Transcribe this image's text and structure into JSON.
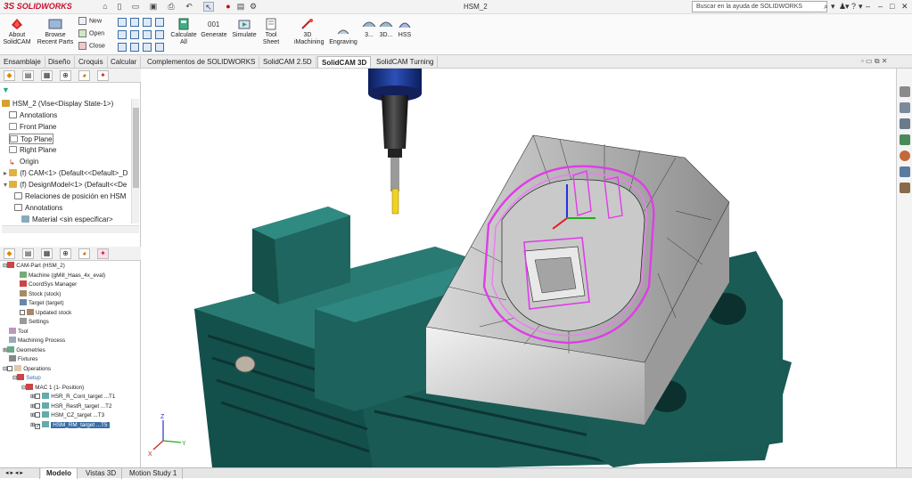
{
  "app": {
    "logo_ds": "3S",
    "logo_text": "SOLIDWORKS",
    "doc_title": "HSM_2",
    "help_search_placeholder": "Buscar en la ayuda de SOLIDWORKS",
    "win_controls": [
      "?",
      "–",
      "□",
      "✕"
    ],
    "help_icons": [
      "⌕",
      "▾",
      "♟",
      "▾",
      "?",
      "▾"
    ]
  },
  "ribbon": {
    "about": "About SolidCAM",
    "browse": "Browse Recent Parts",
    "new": "New",
    "open": "Open",
    "close": "Close",
    "calculate_all": "Calculate All",
    "generate": "Generate",
    "simulate": "Simulate",
    "tool_sheet": "Tool Sheet",
    "imachining": "3D iMachining",
    "engraving": "Engraving",
    "btn_3": "3...",
    "btn_3d": "3D...",
    "hss": "HSS"
  },
  "tabs": [
    "Ensamblaje",
    "Diseño",
    "Croquis",
    "Calcular",
    "Complementos de SOLIDWORKS",
    "SolidCAM 2.5D",
    "SolidCAM 3D",
    "SolidCAM Turning"
  ],
  "active_tab": "SolidCAM 3D",
  "feature_tree": {
    "root": "HSM_2  (Vise<Display State-1>)",
    "items": [
      "Annotations",
      "Front Plane",
      "Top Plane",
      "Right Plane",
      "Origin",
      "(f) CAM<1> (Default<<Default>_D",
      "(f) DesignModel<1> (Default<<De",
      "Relaciones de posición en HSM",
      "Annotations",
      "Material <sin especificar>"
    ]
  },
  "cam_tree": {
    "items": [
      "CAM-Part (HSM_2)",
      "Machine (gMill_Haas_4x_eval)",
      "CoordSys Manager",
      "Stock (stock)",
      "Target (target)",
      "Updated stock",
      "Settings",
      "Tool",
      "Machining Process",
      "Geometries",
      "Fixtures",
      "Operations",
      "Setup",
      "MAC 1 (1- Position)",
      "HSR_R_Cont_target ...T1",
      "HSR_RestR_target ...T2",
      "HSM_CZ_target ...T3",
      "HSM_RM_target ...T5"
    ]
  },
  "bottom_tabs": [
    "Modelo",
    "Vistas 3D",
    "Motion Study 1"
  ],
  "colors": {
    "accent": "#3a6ea5",
    "vise": "#1f5c57",
    "toolpath": "#e13ce8",
    "logo_red": "#c8102e"
  }
}
